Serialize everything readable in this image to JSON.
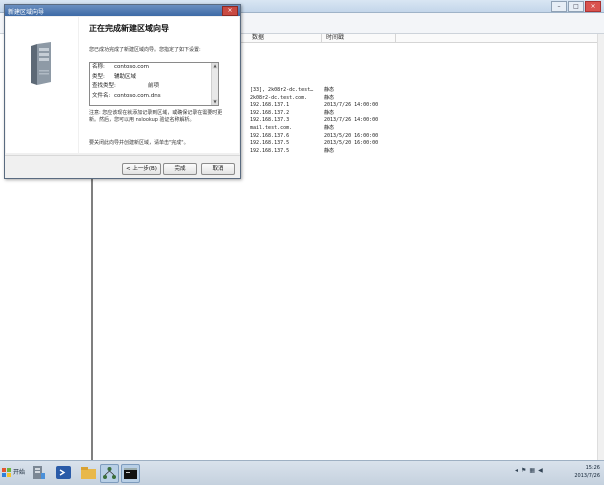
{
  "background_window": {
    "list_columns": [
      "数据",
      "时间戳"
    ],
    "rows": [
      {
        "data": "[33], 2k08r2-dc.test…",
        "timestamp": "静态"
      },
      {
        "data": "2k08r2-dc.test.com.",
        "timestamp": "静态"
      },
      {
        "data": "192.168.137.1",
        "timestamp": "2013/7/26 14:00:00"
      },
      {
        "data": "192.168.137.2",
        "timestamp": "静态"
      },
      {
        "data": "192.168.137.3",
        "timestamp": "2013/7/26 14:00:00"
      },
      {
        "data": "mail.test.com.",
        "timestamp": "静态"
      },
      {
        "data": "192.168.137.6",
        "timestamp": "2013/5/20 16:00:00"
      },
      {
        "data": "192.168.137.5",
        "timestamp": "2013/5/20 16:00:00"
      },
      {
        "data": "192.168.137.5",
        "timestamp": "静态"
      }
    ]
  },
  "dialog": {
    "title": "新建区域向导",
    "close_label": "×",
    "heading": "正在完成新建区域向导",
    "subtext": "您已成功完成了新建区域向导。您指定了如下设置:",
    "summary": [
      {
        "key": "名称:",
        "value": "contoso.com",
        "extra": ""
      },
      {
        "key": "类型:",
        "value": "辅助区域",
        "extra": ""
      },
      {
        "key": "查找类型:",
        "value": "",
        "extra": "前项"
      },
      {
        "key": "文件名:",
        "value": "contoso.com.dns",
        "extra": ""
      }
    ],
    "note": "注意: 您应该现在就添加记录到区域，或确保记录在需要时更新。然后，您可以用 nslookup 验证名称解析。",
    "finish_text": "要关闭此向导并创建新区域，请单击\"完成\"。",
    "buttons": {
      "back": "< 上一步(B)",
      "finish": "完成",
      "cancel": "取消"
    }
  },
  "taskbar": {
    "start_label": "开始",
    "clock_time": "15:26",
    "clock_date": "2013/7/26"
  }
}
